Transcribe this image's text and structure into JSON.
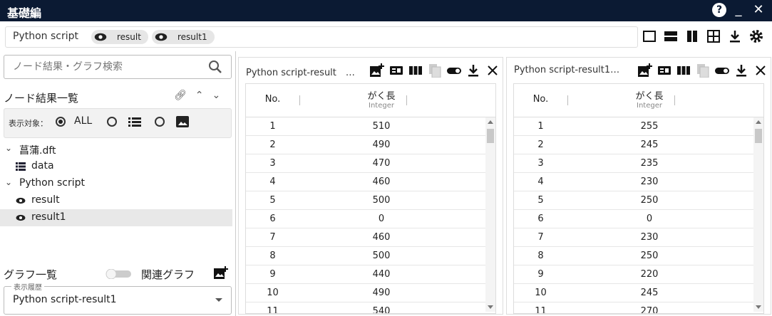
{
  "window": {
    "title": "基礎編"
  },
  "breadcrumb": {
    "title": "Python script",
    "chips": [
      "result",
      "result1"
    ]
  },
  "search": {
    "placeholder": "ノード結果・グラフ検索"
  },
  "node_results": {
    "title": "ノード結果一覧",
    "filter_label": "表示対象：",
    "filter_all": "ALL",
    "tree": [
      {
        "label": "菖蒲.dft",
        "icon": "chevron-down-icon"
      },
      {
        "label": "data",
        "icon": "list-icon"
      },
      {
        "label": "Python script",
        "icon": "chevron-down-icon"
      },
      {
        "label": "result",
        "icon": "eye-icon"
      },
      {
        "label": "result1",
        "icon": "eye-icon"
      }
    ]
  },
  "graphs": {
    "title": "グラフ一覧",
    "related": "関連グラフ",
    "history_legend": "表示履歴",
    "history_value": "Python script-result1"
  },
  "panels": [
    {
      "title": "Python script-result　…",
      "col_no": "No.",
      "col_name": "がく長",
      "col_type": "Integer",
      "rows": [
        [
          "1",
          "510"
        ],
        [
          "2",
          "490"
        ],
        [
          "3",
          "470"
        ],
        [
          "4",
          "460"
        ],
        [
          "5",
          "500"
        ],
        [
          "6",
          "0"
        ],
        [
          "7",
          "460"
        ],
        [
          "8",
          "500"
        ],
        [
          "9",
          "440"
        ],
        [
          "10",
          "490"
        ],
        [
          "11",
          "540"
        ]
      ]
    },
    {
      "title": "Python script-result1…",
      "col_no": "No.",
      "col_name": "がく長",
      "col_type": "Integer",
      "rows": [
        [
          "1",
          "255"
        ],
        [
          "2",
          "245"
        ],
        [
          "3",
          "235"
        ],
        [
          "4",
          "230"
        ],
        [
          "5",
          "250"
        ],
        [
          "6",
          "0"
        ],
        [
          "7",
          "230"
        ],
        [
          "8",
          "250"
        ],
        [
          "9",
          "220"
        ],
        [
          "10",
          "245"
        ],
        [
          "11",
          "270"
        ]
      ]
    }
  ],
  "colors": {
    "titlebar": "#0b1a33",
    "selection": "#e8e8e8"
  }
}
